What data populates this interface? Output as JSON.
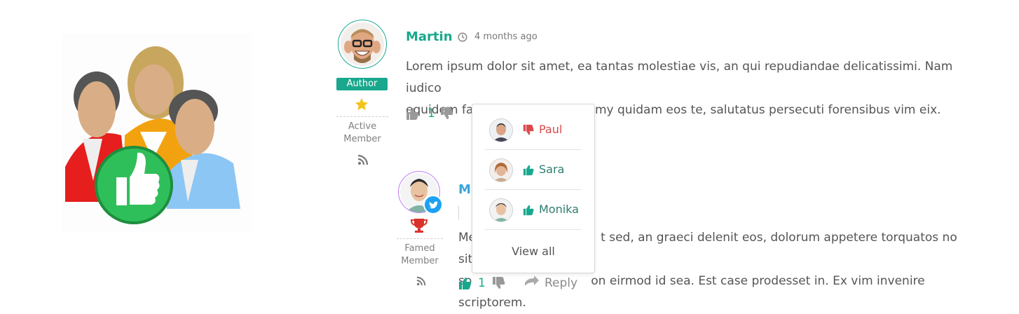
{
  "comment1": {
    "author": "Martin",
    "time": "4 months ago",
    "badge": "Author",
    "rank_line1": "Active",
    "rank_line2": "Member",
    "text_line1": "Lorem ipsum dolor sit amet, ea tantas molestiae vis, an qui repudiandae delicatissimi. Nam iudico",
    "text_line2": "equidem fabulas in, agam nonumy quidam eos te, salutatus persecuti forensibus vim eix.",
    "likes": "1"
  },
  "comment2": {
    "author": "M",
    "rank_line1": "Famed",
    "rank_line2": "Member",
    "text_line1_left": "Me",
    "text_line1_right": "t sed, an graeci delenit eos, dolorum appetere torquatos no sit. Ea est",
    "text_line2_left": "so",
    "text_line2_right": "on eirmod id sea. Est case prodesset in. Ex vim invenire scriptorem.",
    "likes": "1",
    "reply_label": "Reply"
  },
  "votes_popup": {
    "voters": [
      {
        "name": "Paul",
        "vote": "down"
      },
      {
        "name": "Sara",
        "vote": "up"
      },
      {
        "name": "Monika",
        "vote": "up"
      }
    ],
    "view_all": "View all"
  },
  "colors": {
    "accent": "#19a88d",
    "downvote": "#d94b4b",
    "author2": "#3aa6d8",
    "twitter": "#1da1f2"
  }
}
